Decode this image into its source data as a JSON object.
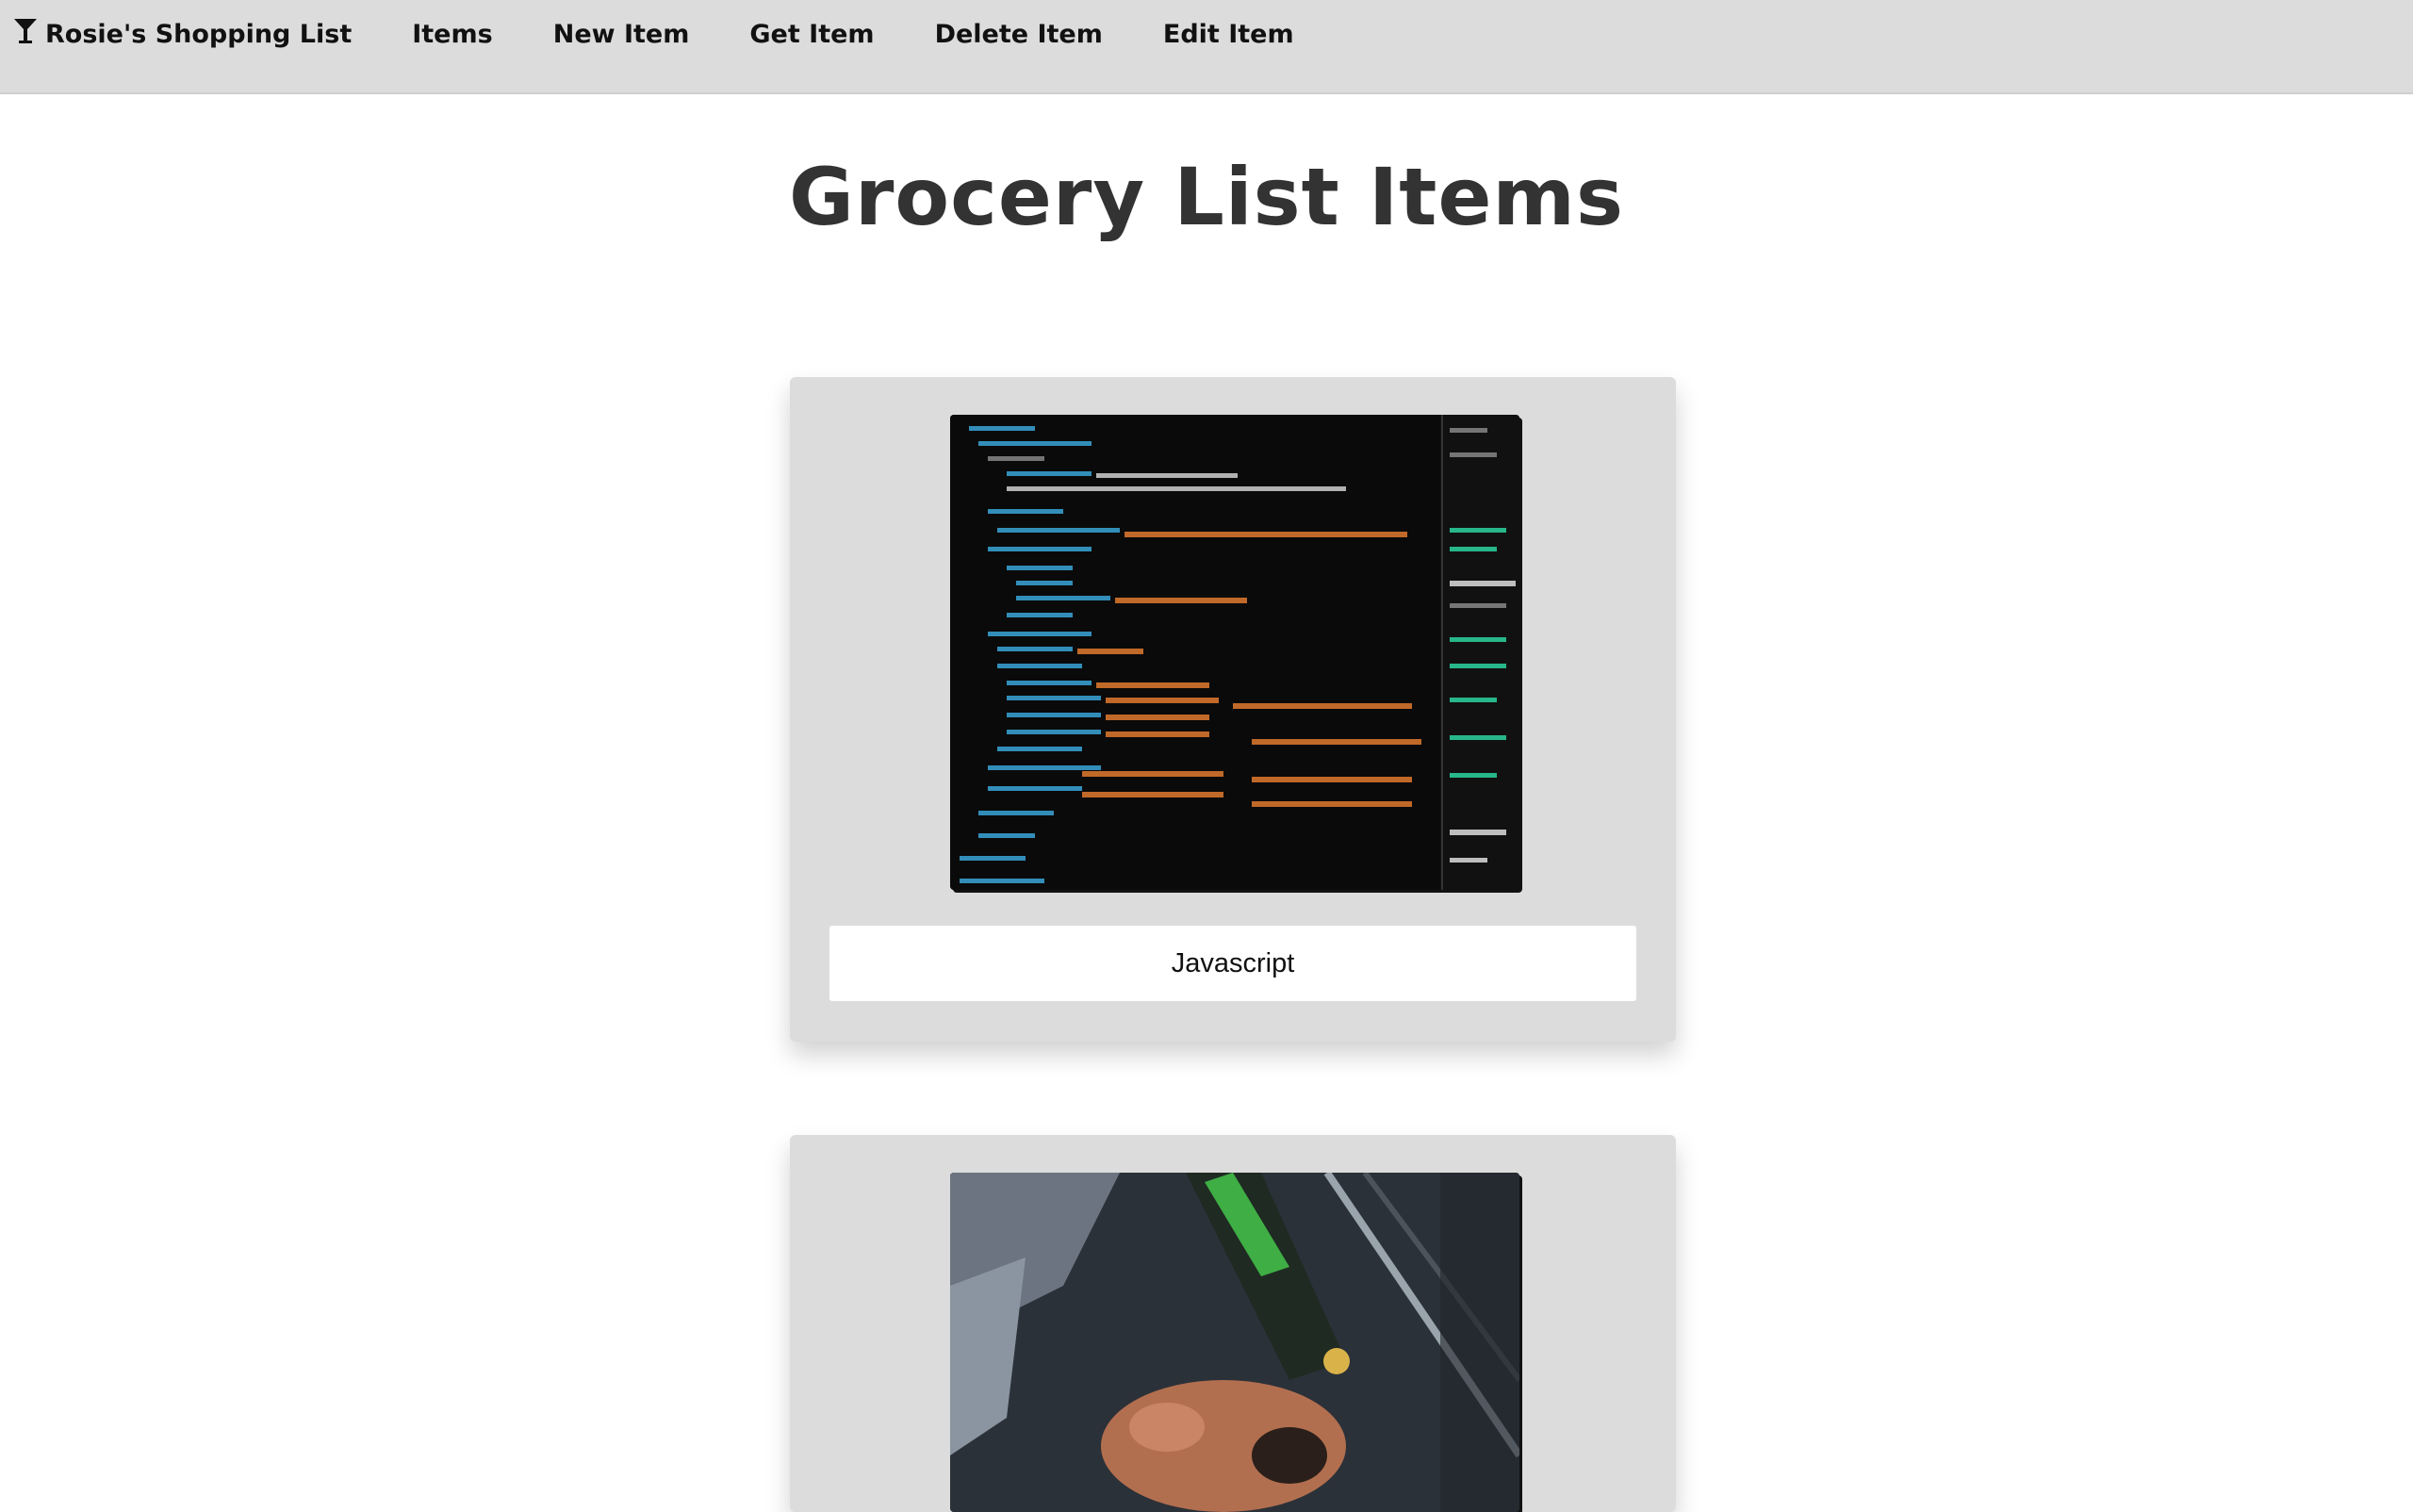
{
  "nav": {
    "brand_icon": "cocktail-glass-icon",
    "brand": "Rosie's Shopping List",
    "links": [
      "Items",
      "New Item",
      "Get Item",
      "Delete Item",
      "Edit Item"
    ]
  },
  "page": {
    "title": "Grocery List Items"
  },
  "items": [
    {
      "label": "Javascript",
      "image": "code-editor-photo"
    },
    {
      "label": "",
      "image": "hands-repairing-bike-photo"
    }
  ],
  "colors": {
    "navbar_bg": "#dcdcdc",
    "card_bg": "#dcdcdc",
    "title_text": "#333333",
    "code_orange": "#e07a2e",
    "code_blue": "#3aa6d8"
  }
}
